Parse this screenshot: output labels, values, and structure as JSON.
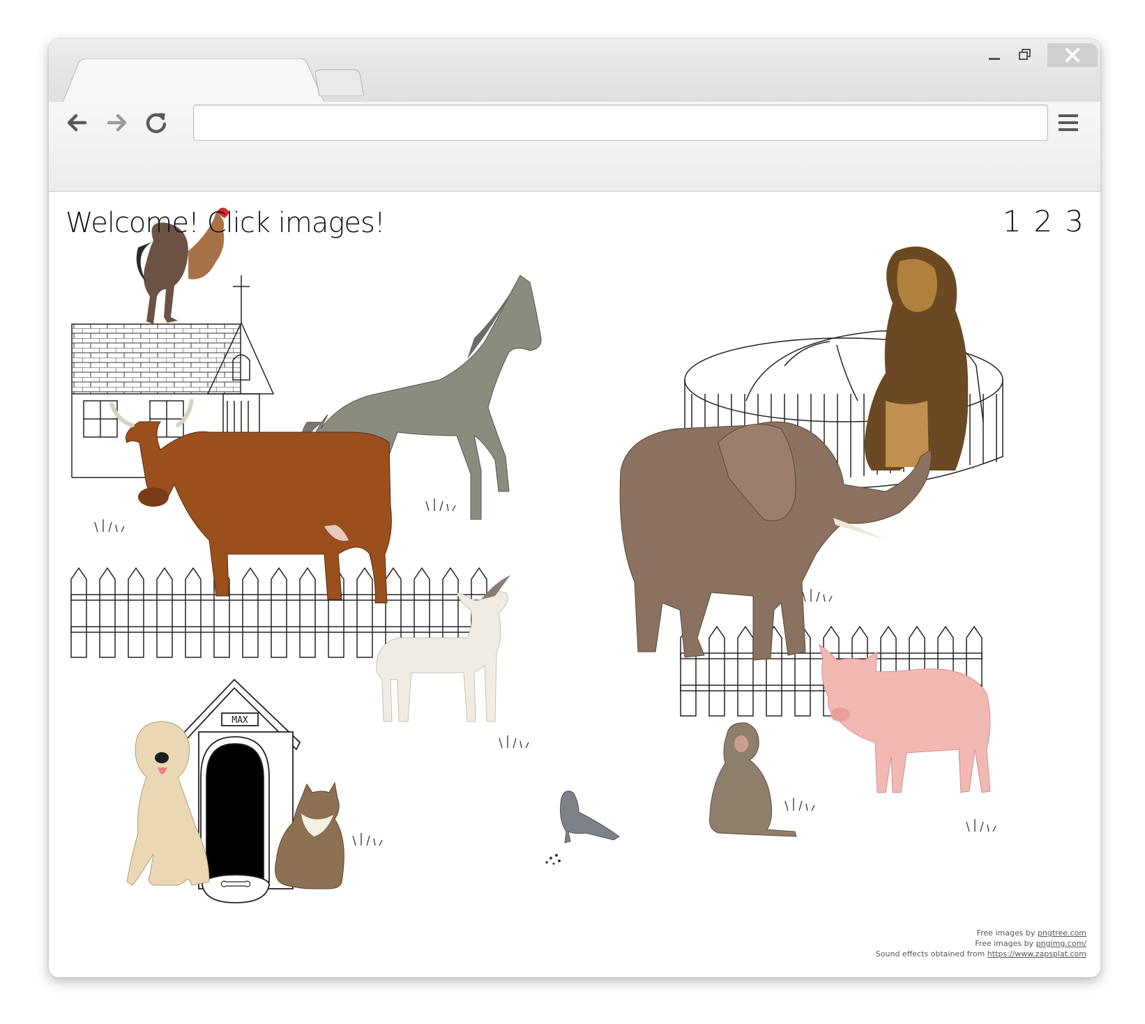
{
  "browser": {
    "address_value": "",
    "icons": [
      "back-arrow-icon",
      "forward-arrow-icon",
      "reload-icon",
      "menu-icon",
      "minimize-icon",
      "maximize-icon",
      "close-icon"
    ]
  },
  "page": {
    "title": "Welcome! Click images!",
    "pages": [
      "1",
      "2",
      "3"
    ],
    "doghouse_sign": "MAX"
  },
  "credits": [
    {
      "prefix": "Free images by ",
      "link": "pngtree.com"
    },
    {
      "prefix": "Free images by ",
      "link": "pngimg.com/"
    },
    {
      "prefix": "Sound effects obtained from ",
      "link": "https://www.zapsplat.com"
    }
  ],
  "animals": [
    "rooster",
    "horse",
    "cow",
    "goat",
    "dog",
    "cat",
    "lion",
    "elephant",
    "pig",
    "monkey",
    "pigeon"
  ],
  "colors": {
    "window_close_bg": "#cfcfcf",
    "cow": "#9a4f1d",
    "horse": "#8b8b80",
    "elephant": "#8a7160",
    "pig": "#f2b8b4",
    "lion": "#b0813c",
    "goat": "#f0ece4",
    "dog": "#ead7b4",
    "cat": "#8d7052",
    "monkey": "#8e7e6c",
    "pigeon": "#7d8289",
    "rooster": "#a87248"
  }
}
